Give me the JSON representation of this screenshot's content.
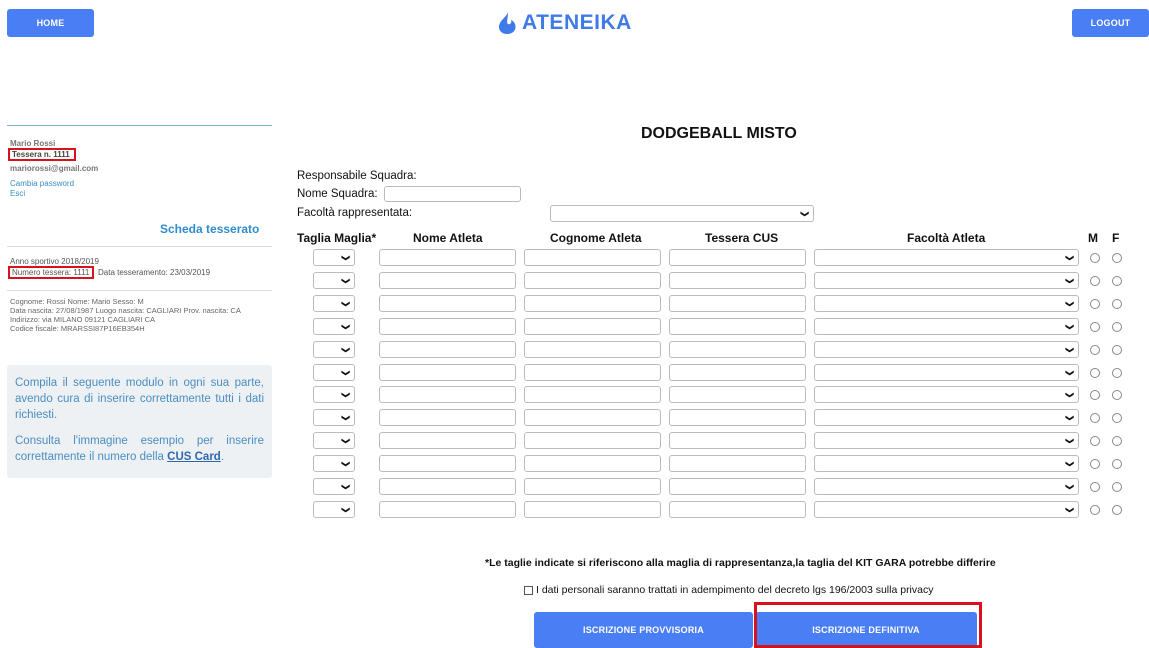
{
  "header": {
    "home_label": "HOME",
    "logout_label": "LOGOUT",
    "brand": "ATENEIKA",
    "brand_color": "#3f7be8"
  },
  "sidebar": {
    "user_name": "Mario Rossi",
    "tessera": "Tessera n. 1111",
    "email": "mariorossi@gmail.com",
    "change_password": "Cambia password",
    "logout_link": "Esci",
    "card_title": "Scheda tesserato",
    "sport_year": "Anno sportivo 2018/2019",
    "card_number": "Numero tessera: 1111",
    "card_date": "Data tesseramento: 23/03/2019",
    "details": [
      "Cognome: Rossi   Nome: Mario Sesso: M",
      "Data nascita: 27/08/1987   Luogo nascita: CAGLIARI   Prov. nascita: CA",
      "Indirizzo: via MILANO 09121 CAGLIARI CA",
      "Codice fiscale: MRARSSI87P16EB354H"
    ],
    "info_p1": "Compila il seguente modulo in ogni sua parte, avendo cura di inserire correttamente tutti i dati richiesti.",
    "info_p2_prefix": "Consulta l'immagine esempio per inserire correttamente il numero della ",
    "info_p2_link": "CUS Card",
    "info_p2_suffix": "."
  },
  "form": {
    "title": "DODGEBALL MISTO",
    "responsabile_label": "Responsabile Squadra:",
    "nome_squadra_label": "Nome Squadra:",
    "facolta_label": "Facoltà rappresentata:",
    "columns": {
      "taglia": "Taglia Maglia*",
      "nome": "Nome Atleta",
      "cognome": "Cognome Atleta",
      "tessera": "Tessera CUS",
      "facolta": "Facoltà Atleta",
      "m": "M",
      "f": "F"
    },
    "row_count": 12,
    "taglie_note": "*Le taglie indicate si riferiscono alla maglia di rappresentanza,la taglia del KIT GARA potrebbe differire",
    "privacy_label": "I dati personali saranno trattati in adempimento del decreto lgs 196/2003 sulla privacy",
    "btn_provvisoria": "ISCRIZIONE PROVVISORIA",
    "btn_definitiva": "ISCRIZIONE DEFINITIVA"
  }
}
